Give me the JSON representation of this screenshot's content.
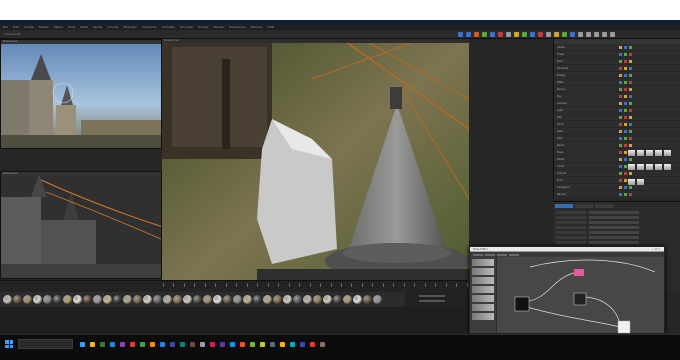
{
  "window": {
    "title": "Cinema 4D"
  },
  "menubar": {
    "items": [
      "File",
      "Edit",
      "Create",
      "Modes",
      "Select",
      "Tools",
      "Mesh",
      "Spline",
      "Volume",
      "MoGraph",
      "Character",
      "Animate",
      "Simulate",
      "Tracker",
      "Render",
      "Extensions",
      "Window",
      "Help"
    ]
  },
  "toolbar": {
    "icon_colors": [
      "#3a73c9",
      "#3a73c9",
      "#d45a2a",
      "#5aa83e",
      "#3a73c9",
      "#c43a3a",
      "#9a9a9a",
      "#d4a52a",
      "#5aa83e",
      "#3a73c9",
      "#c43a3a",
      "#9a9a9a",
      "#d4a52a",
      "#5aa83e",
      "#3a73c9",
      "#9a9a9a",
      "#9a9a9a",
      "#9a9a9a",
      "#9a9a9a",
      "#9a9a9a"
    ]
  },
  "viewports": {
    "top_left": {
      "label": "Perspective"
    },
    "mid_left": {
      "label": "Perspective"
    },
    "main": {
      "label": "Perspective"
    }
  },
  "materials": {
    "swatch_colors": [
      "#c9c3b8",
      "#6b5a44",
      "#a08b64",
      "#d6d3cc",
      "#8a8a8a",
      "#4d4b45",
      "#b39a6a",
      "#e0ddd5",
      "#5e4a36",
      "#9c9c9c",
      "#c7b48a",
      "#3f3f3f",
      "#ada593",
      "#7b6a4f",
      "#d8d2c3",
      "#6c6c6c",
      "#b8b0a0",
      "#8e7856",
      "#cfcac0",
      "#555046",
      "#a39475",
      "#e3dfd6",
      "#70604a",
      "#909090",
      "#c5b38e",
      "#484848",
      "#b2a990",
      "#83704f",
      "#d4cfc4",
      "#626262",
      "#bdb4a1",
      "#957f5c",
      "#d0cbc2",
      "#524d44",
      "#a69878",
      "#e1ddd4",
      "#6e5e48",
      "#959595"
    ]
  },
  "object_manager": {
    "rows": [
      "Castle",
      "Tower",
      "Roof",
      "Windows",
      "Bridge",
      "Walls",
      "Terrain",
      "Sky",
      "Camera",
      "Light",
      "Hall",
      "Spire",
      "Gate",
      "Path",
      "Rocks",
      "Trees",
      "Water",
      "Cloud",
      "Ground",
      "Floor",
      "Courtyard",
      "Banner"
    ],
    "tag_colors": [
      "#d4a52a",
      "#3a73c9",
      "#5aa83e",
      "#c43a3a"
    ]
  },
  "attributes": {
    "tabs": [
      "Basic",
      "Coord",
      "Object"
    ]
  },
  "node_editor": {
    "title": "Node Editor",
    "tabs": [
      "Material",
      "Nodes"
    ]
  },
  "taskbar": {
    "icon_colors": [
      "#3aa0ff",
      "#f0b429",
      "#2d7d46",
      "#1e88e5",
      "#8e44ad",
      "#e53935",
      "#43a047",
      "#fb8c00",
      "#1e88e5",
      "#3949ab",
      "#00897b",
      "#6d4c41",
      "#9e9e9e",
      "#d81b60",
      "#5e35b1",
      "#039be5",
      "#f4511e",
      "#7cb342",
      "#c0ca33",
      "#546e7a",
      "#ffb300",
      "#00acc1",
      "#3949ab",
      "#e53935",
      "#8d6e63"
    ]
  }
}
